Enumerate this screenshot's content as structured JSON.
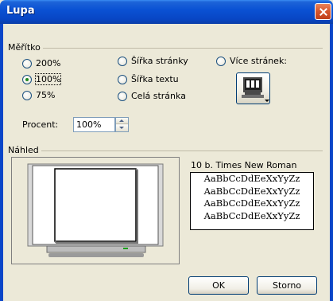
{
  "window": {
    "title": "Lupa"
  },
  "zoom_group": {
    "label": "Měřítko",
    "options": [
      {
        "label": "200%",
        "checked": false
      },
      {
        "label": "100%",
        "checked": true
      },
      {
        "label": "75%",
        "checked": false
      },
      {
        "label": "Šířka stránky",
        "checked": false
      },
      {
        "label": "Šířka textu",
        "checked": false
      },
      {
        "label": "Celá stránka",
        "checked": false
      },
      {
        "label": "Více stránek:",
        "checked": false
      }
    ],
    "percent_label": "Procent:",
    "percent_value": "100%",
    "pages_button_icon": "monitor-pages-icon"
  },
  "preview_group": {
    "label": "Náhled",
    "font_caption": "10 b. Times New Roman",
    "sample_lines": [
      "AaBbCcDdEeXxYyZz",
      "AaBbCcDdEeXxYyZz",
      "AaBbCcDdEeXxYyZz",
      "AaBbCcDdEeXxYyZz"
    ]
  },
  "buttons": {
    "ok": "OK",
    "cancel": "Storno"
  },
  "colors": {
    "titlebar": "#0a52d4",
    "dialog_bg": "#ece9d8",
    "close": "#d4542c"
  }
}
